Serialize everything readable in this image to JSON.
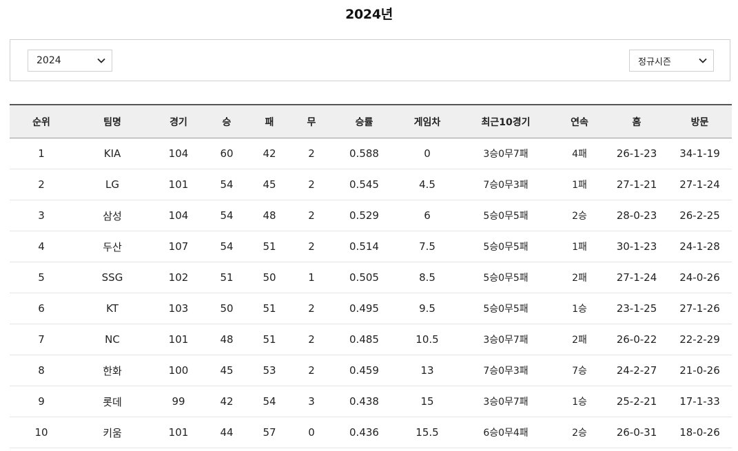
{
  "page_title": "2024년",
  "filters": {
    "year": "2024",
    "season": "정규시즌"
  },
  "table": {
    "headers": [
      "순위",
      "팀명",
      "경기",
      "승",
      "패",
      "무",
      "승률",
      "게임차",
      "최근10경기",
      "연속",
      "홈",
      "방문"
    ],
    "rows": [
      [
        "1",
        "KIA",
        "104",
        "60",
        "42",
        "2",
        "0.588",
        "0",
        "3승0무7패",
        "4패",
        "26-1-23",
        "34-1-19"
      ],
      [
        "2",
        "LG",
        "101",
        "54",
        "45",
        "2",
        "0.545",
        "4.5",
        "7승0무3패",
        "1패",
        "27-1-21",
        "27-1-24"
      ],
      [
        "3",
        "삼성",
        "104",
        "54",
        "48",
        "2",
        "0.529",
        "6",
        "5승0무5패",
        "2승",
        "28-0-23",
        "26-2-25"
      ],
      [
        "4",
        "두산",
        "107",
        "54",
        "51",
        "2",
        "0.514",
        "7.5",
        "5승0무5패",
        "1패",
        "30-1-23",
        "24-1-28"
      ],
      [
        "5",
        "SSG",
        "102",
        "51",
        "50",
        "1",
        "0.505",
        "8.5",
        "5승0무5패",
        "2패",
        "27-1-24",
        "24-0-26"
      ],
      [
        "6",
        "KT",
        "103",
        "50",
        "51",
        "2",
        "0.495",
        "9.5",
        "5승0무5패",
        "1승",
        "23-1-25",
        "27-1-26"
      ],
      [
        "7",
        "NC",
        "101",
        "48",
        "51",
        "2",
        "0.485",
        "10.5",
        "3승0무7패",
        "2패",
        "26-0-22",
        "22-2-29"
      ],
      [
        "8",
        "한화",
        "100",
        "45",
        "53",
        "2",
        "0.459",
        "13",
        "7승0무3패",
        "7승",
        "24-2-27",
        "21-0-26"
      ],
      [
        "9",
        "롯데",
        "99",
        "42",
        "54",
        "3",
        "0.438",
        "15",
        "3승0무7패",
        "1승",
        "25-2-21",
        "17-1-33"
      ],
      [
        "10",
        "키움",
        "101",
        "44",
        "57",
        "0",
        "0.436",
        "15.5",
        "6승0무4패",
        "2승",
        "26-0-31",
        "18-0-26"
      ]
    ]
  },
  "icons": {
    "dropdown": "chevron-down-icon"
  }
}
